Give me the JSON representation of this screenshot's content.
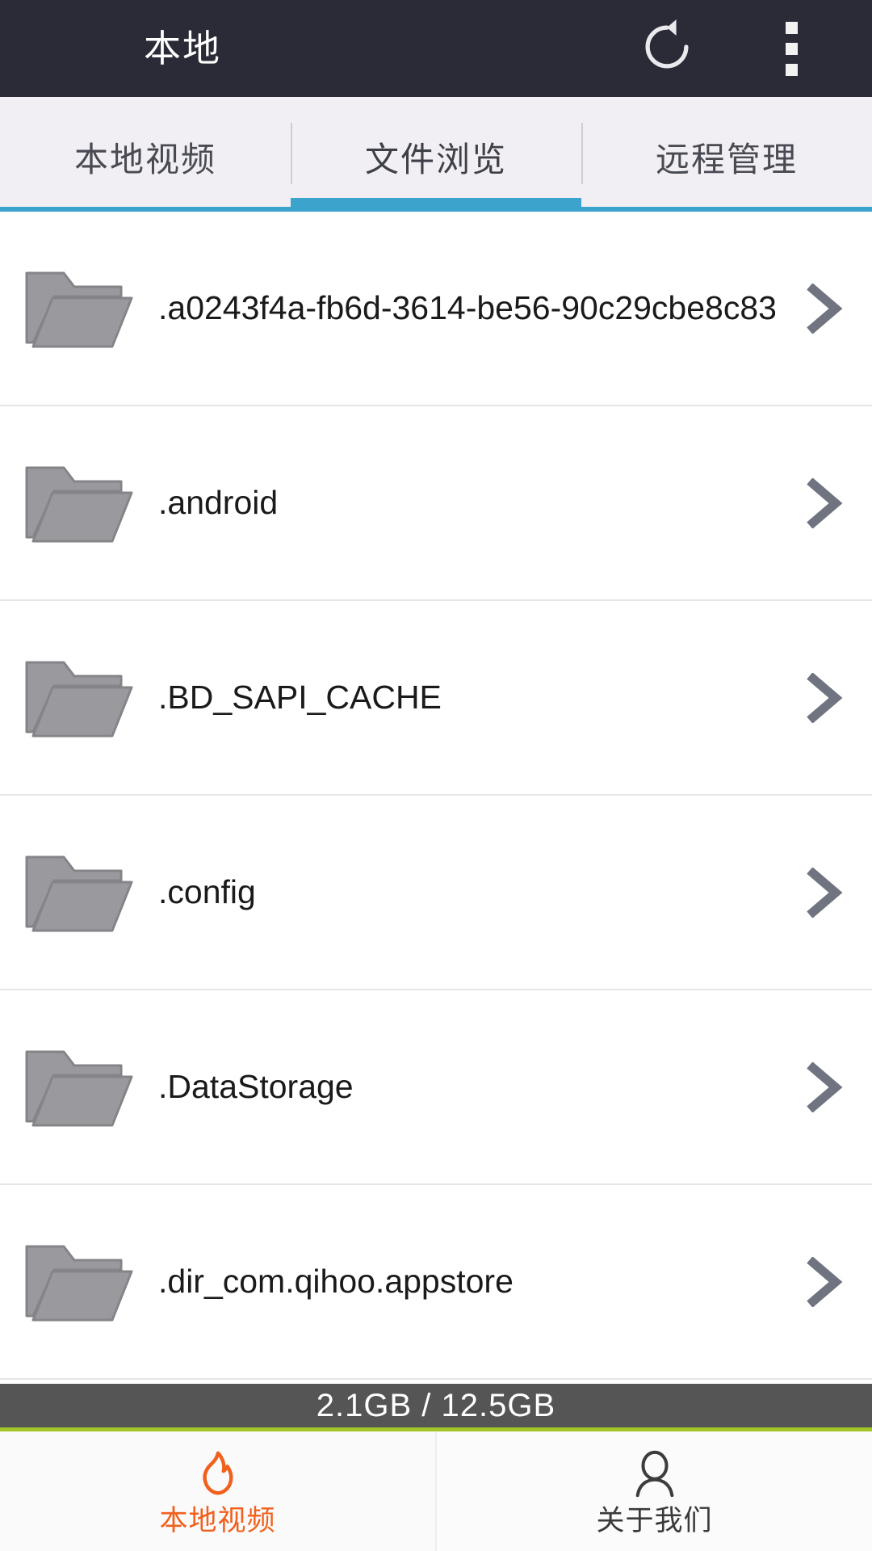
{
  "header": {
    "title": "本地",
    "refresh_icon": "refresh-icon",
    "overflow_icon": "overflow-menu-icon"
  },
  "tabs": {
    "active_index": 1,
    "items": [
      {
        "label": "本地视频"
      },
      {
        "label": "文件浏览"
      },
      {
        "label": "远程管理"
      }
    ]
  },
  "file_list": {
    "items": [
      {
        "name": ".a0243f4a-fb6d-3614-be56-90c29cbe8c83",
        "icon": "folder-icon",
        "chevron": "chevron-right-icon"
      },
      {
        "name": ".android",
        "icon": "folder-icon",
        "chevron": "chevron-right-icon"
      },
      {
        "name": ".BD_SAPI_CACHE",
        "icon": "folder-icon",
        "chevron": "chevron-right-icon"
      },
      {
        "name": ".config",
        "icon": "folder-icon",
        "chevron": "chevron-right-icon"
      },
      {
        "name": ".DataStorage",
        "icon": "folder-icon",
        "chevron": "chevron-right-icon"
      },
      {
        "name": ".dir_com.qihoo.appstore",
        "icon": "folder-icon",
        "chevron": "chevron-right-icon"
      }
    ]
  },
  "storage": {
    "text": "2.1GB / 12.5GB",
    "used": "2.1GB",
    "total": "12.5GB"
  },
  "bottom_nav": {
    "active_index": 0,
    "items": [
      {
        "label": "本地视频",
        "icon": "flame-icon"
      },
      {
        "label": "关于我们",
        "icon": "person-icon"
      }
    ]
  },
  "colors": {
    "appbar_bg": "#2b2b38",
    "tab_bg": "#f1eff4",
    "accent_blue": "#3ca3cc",
    "storage_bg": "#555555",
    "storage_divider": "#a2c627",
    "nav_active": "#f1601d",
    "folder_gray": "#9a9a9e"
  }
}
